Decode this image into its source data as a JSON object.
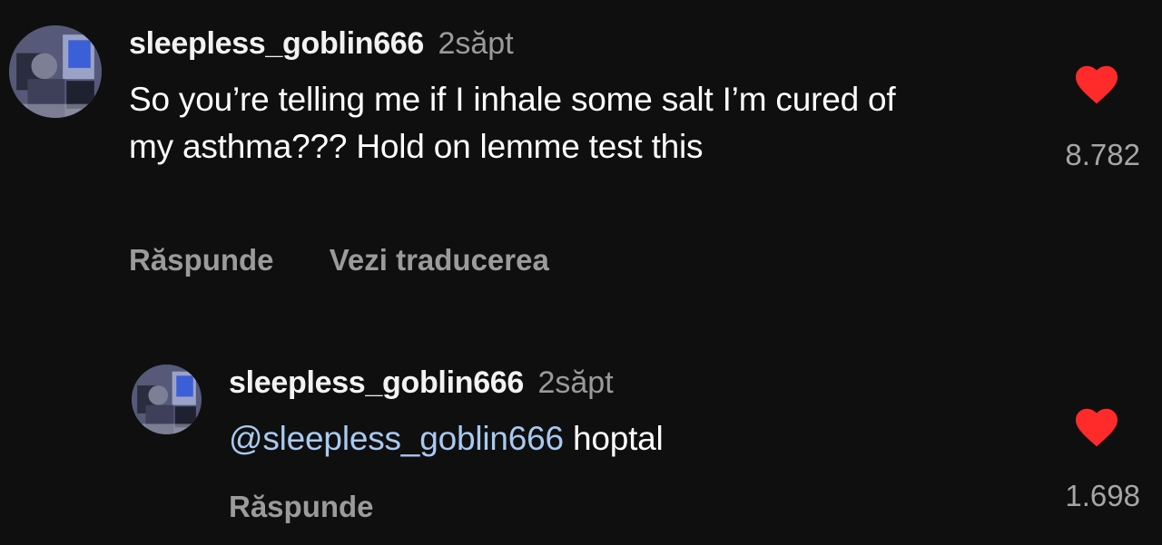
{
  "colors": {
    "background": "#0f0f0f",
    "heart": "#ff2a2a",
    "mention": "#a9c9f0",
    "muted": "#9b9b9b"
  },
  "comments": [
    {
      "username": "sleepless_goblin666",
      "time": "2săpt",
      "text": "So you’re telling me if I inhale some salt I’m cured of my asthma??? Hold on lemme test this",
      "actions": {
        "reply": "Răspunde",
        "translate": "Vezi traducerea"
      },
      "likes": "8.782",
      "heart_icon": "heart-icon"
    },
    {
      "username": "sleepless_goblin666",
      "time": "2săpt",
      "mention": "@sleepless_goblin666",
      "text": " hoptal",
      "actions": {
        "reply": "Răspunde"
      },
      "likes": "1.698",
      "heart_icon": "heart-icon"
    }
  ]
}
